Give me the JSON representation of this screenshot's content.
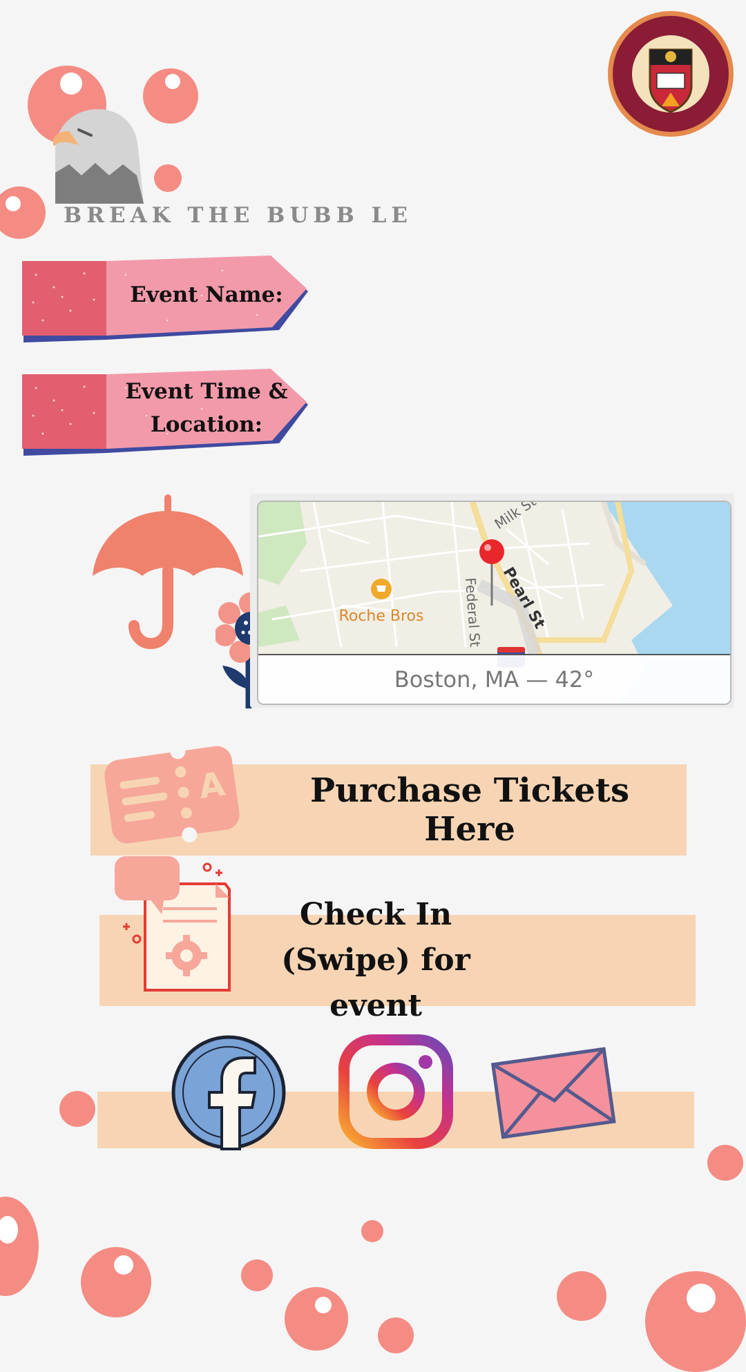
{
  "brand": {
    "title": "BREAK THE BUBB LE"
  },
  "seal": {
    "alt": "Collegium Bostoniense seal"
  },
  "tags": {
    "event_name": "Event Name:",
    "event_time_location": "Event Time & Location:"
  },
  "map": {
    "caption": "Boston, MA — 42°",
    "labels": {
      "store": "Roche Bros",
      "street_pearl": "Pearl St",
      "street_federal": "Federal St",
      "street_milk": "Milk St"
    }
  },
  "actions": {
    "purchase": "Purchase Tickets Here",
    "checkin": "Check In (Swipe) for event"
  },
  "social": [
    "facebook",
    "instagram",
    "email"
  ],
  "colors": {
    "bubble": "#f48c84",
    "peach": "#f7d5b4",
    "pink": "#f29aaa",
    "crimson": "#e45e6d",
    "background": "#f5f5f5"
  }
}
